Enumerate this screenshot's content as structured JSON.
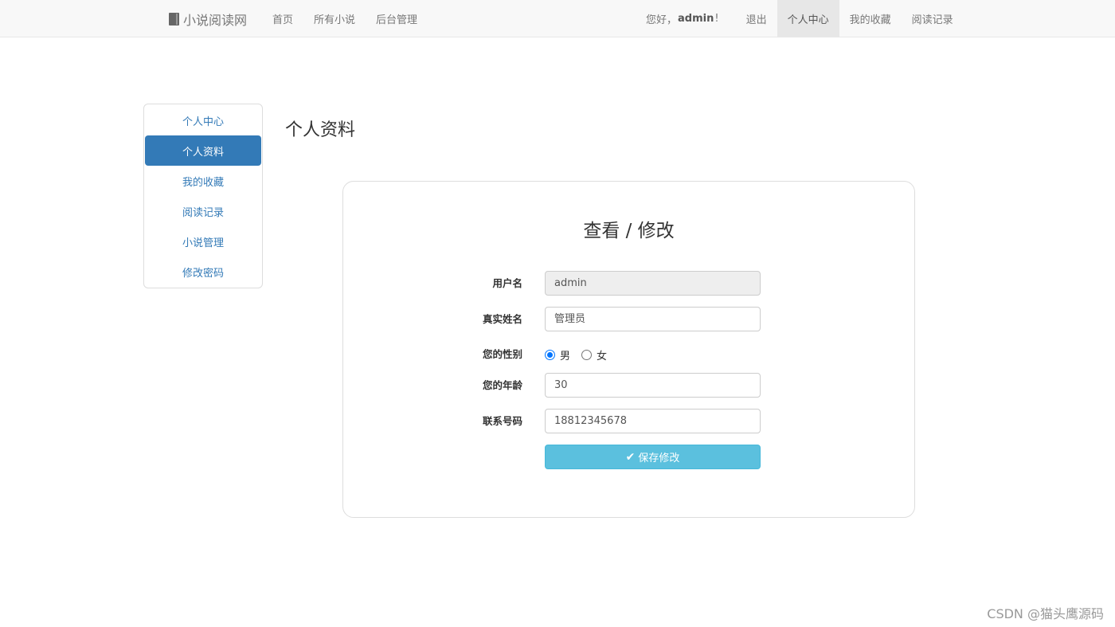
{
  "navbar": {
    "brand": "小说阅读网",
    "brand_icon": "book-icon",
    "left_items": [
      "首页",
      "所有小说",
      "后台管理"
    ],
    "greeting_prefix": "您好，",
    "greeting_user": "admin",
    "greeting_suffix": "!",
    "right_items": [
      "退出",
      "个人中心",
      "我的收藏",
      "阅读记录"
    ],
    "active_item": "个人中心"
  },
  "sidebar": {
    "items": [
      {
        "label": "个人中心"
      },
      {
        "label": "个人资料"
      },
      {
        "label": "我的收藏"
      },
      {
        "label": "阅读记录"
      },
      {
        "label": "小说管理"
      },
      {
        "label": "修改密码"
      }
    ],
    "active_item": "个人资料"
  },
  "page_title": "个人资料",
  "panel": {
    "title": "查看 / 修改",
    "fields": {
      "username": {
        "label": "用户名",
        "value": "admin"
      },
      "realname": {
        "label": "真实姓名",
        "value": "管理员"
      },
      "gender": {
        "label": "您的性别",
        "options": [
          "男",
          "女"
        ],
        "selected": "男"
      },
      "age": {
        "label": "您的年龄",
        "value": "30"
      },
      "phone": {
        "label": "联系号码",
        "value": "18812345678"
      }
    },
    "save_label": "保存修改",
    "save_icon": "check-icon"
  },
  "colors": {
    "primary": "#337ab7",
    "info": "#5bc0de",
    "navbar_bg": "#f8f8f8"
  },
  "watermark": "CSDN @猫头鹰源码"
}
